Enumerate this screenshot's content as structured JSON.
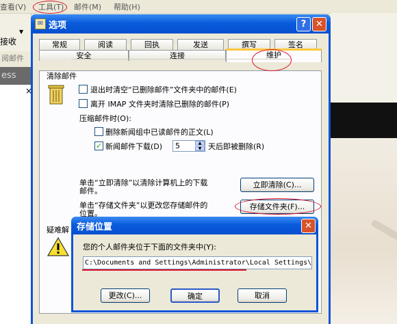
{
  "background_app": {
    "menu": [
      "查看(V)",
      "工具(T)",
      "邮件(M)",
      "帮助(H)"
    ],
    "toolbar_recv": "接收",
    "strip_text": "阅邮件",
    "dark_bar_text": "ess",
    "close_glyph": "×"
  },
  "options_dialog": {
    "title": "选项",
    "help_glyph": "?",
    "close_glyph": "✕",
    "tabs_back": [
      "常规",
      "阅读",
      "回执",
      "发送",
      "撰写",
      "签名"
    ],
    "tabs_front": [
      "安全",
      "连接",
      "维护"
    ],
    "active_tab": "维护",
    "section_title": "清除邮件",
    "opt_empty_deleted": "退出时清空“已删除邮件”文件夹中的邮件(E)",
    "opt_purge_imap": "离开 IMAP 文件夹时清除已删除的邮件(P)",
    "compact_label": "压缩邮件时(O):",
    "opt_delete_news_bodies": "删除新闻组中已读邮件的正文(L)",
    "opt_news_download": "新闻邮件下载(D)",
    "days_value": "5",
    "days_suffix": "天后即被删除(R)",
    "clean_desc_1": "单击“立即清除”以清除计算机上的下载",
    "clean_desc_2": "邮件。",
    "clean_now_button": "立即清除(C)...",
    "store_desc_1": "单击“存储文件夹”以更改您存储邮件的",
    "store_desc_2": "位置。",
    "store_folder_button": "存储文件夹(F)...",
    "troubleshoot_label": "疑难解"
  },
  "storage_dialog": {
    "title": "存储位置",
    "close_glyph": "✕",
    "prompt": "您的个人邮件夹位于下面的文件夹中(Y):",
    "path": "C:\\Documents and Settings\\Administrator\\Local Settings\\",
    "change_button": "更改(C)...",
    "ok_button": "确定",
    "cancel_button": "取消"
  },
  "icons": {
    "title_icon": "options-icon",
    "trash_icon": "recycle-bin-icon",
    "warning_icon": "warning-icon"
  }
}
